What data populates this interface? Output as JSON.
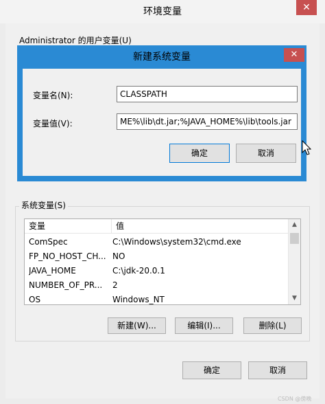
{
  "outer": {
    "title": "环境变量",
    "close_glyph": "✕",
    "user_group_label": "Administrator 的用户变量(U)"
  },
  "system_vars": {
    "group_label": "系统变量(S)",
    "columns": [
      "变量",
      "值"
    ],
    "rows": [
      {
        "name": "ComSpec",
        "value": "C:\\Windows\\system32\\cmd.exe"
      },
      {
        "name": "FP_NO_HOST_CH...",
        "value": "NO"
      },
      {
        "name": "JAVA_HOME",
        "value": "C:\\jdk-20.0.1"
      },
      {
        "name": "NUMBER_OF_PR...",
        "value": "2"
      },
      {
        "name": "OS",
        "value": "Windows_NT"
      }
    ],
    "new_button": "新建(W)...",
    "edit_button": "编辑(I)...",
    "delete_button": "删除(L)"
  },
  "outer_buttons": {
    "ok": "确定",
    "cancel": "取消"
  },
  "dialog": {
    "title": "新建系统变量",
    "close_glyph": "✕",
    "name_label": "变量名(N):",
    "value_label": "变量值(V):",
    "name_value": "CLASSPATH",
    "value_value": "ME%\\lib\\dt.jar;%JAVA_HOME%\\lib\\tools.jar",
    "ok": "确定",
    "cancel": "取消"
  },
  "watermark": "CSDN @傍晚",
  "colors": {
    "dialog_frame": "#2a8ad4",
    "close_button": "#c75050",
    "focus_border": "#0078d7"
  }
}
